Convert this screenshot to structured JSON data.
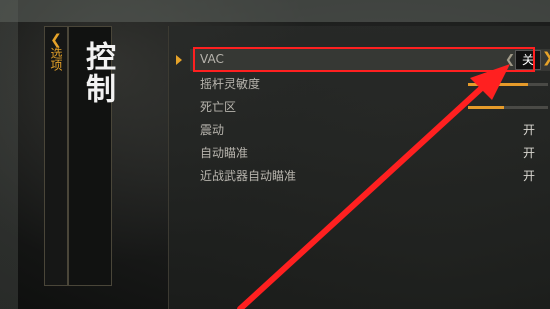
{
  "nav": {
    "back_chevron": "❮",
    "back_label": "选项"
  },
  "page": {
    "title": "控制"
  },
  "settings": [
    {
      "label": "VAC",
      "value": "关",
      "selected": true
    },
    {
      "label": "摇杆灵敏度",
      "slider": 0.75
    },
    {
      "label": "死亡区",
      "slider": 0.45
    },
    {
      "label": "震动",
      "value": "开"
    },
    {
      "label": "自动瞄准",
      "value": "开"
    },
    {
      "label": "近战武器自动瞄准",
      "value": "开"
    }
  ],
  "colors": {
    "accent": "#e6a329",
    "annotation": "#ff2020"
  },
  "annotation": {
    "type": "red-arrow-and-box"
  }
}
